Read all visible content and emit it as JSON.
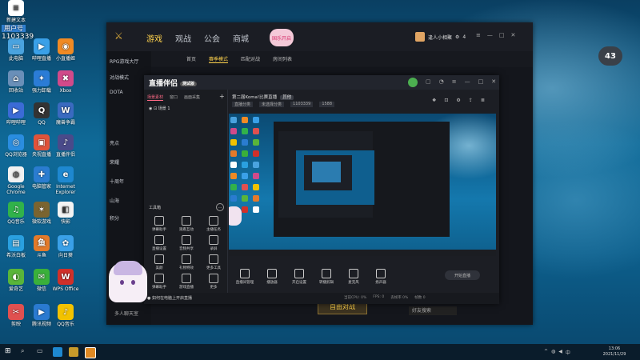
{
  "desktop": {
    "user_label": "用户号",
    "user_id": "1103339",
    "icons": [
      {
        "label": "此电脑",
        "color": "#4aa3df",
        "glyph": "▭"
      },
      {
        "label": "哔哩直播",
        "color": "#3aa0e8",
        "glyph": "▶"
      },
      {
        "label": "小直播姬",
        "color": "#f08a24",
        "glyph": "◉"
      },
      {
        "label": "回收站",
        "color": "#6a8fb8",
        "glyph": "⌂"
      },
      {
        "label": "强力卸载",
        "color": "#2b7cd6",
        "glyph": "✦"
      },
      {
        "label": "Xbox",
        "color": "#d04a8a",
        "glyph": "✖"
      },
      {
        "label": "哔哩哔哩",
        "color": "#3b6bd6",
        "glyph": "▶"
      },
      {
        "label": "QQ",
        "color": "#333",
        "glyph": "Q"
      },
      {
        "label": "魔兽争霸",
        "color": "#3a6ac0",
        "glyph": "W"
      },
      {
        "label": "QQ浏览器",
        "color": "#2a8de0",
        "glyph": "◎"
      },
      {
        "label": "央视直播",
        "color": "#e0533a",
        "glyph": "▣"
      },
      {
        "label": "直播伴侣",
        "color": "#4a4a8a",
        "glyph": "♪"
      },
      {
        "label": "Google Chrome",
        "color": "#f1f1f1",
        "glyph": "◍"
      },
      {
        "label": "电脑管家",
        "color": "#2a7cd0",
        "glyph": "✚"
      },
      {
        "label": "Internet Explorer",
        "color": "#1e88d0",
        "glyph": "e"
      },
      {
        "label": "QQ音乐",
        "color": "#31b24a",
        "glyph": "♫"
      },
      {
        "label": "微软游戏",
        "color": "#7a6430",
        "glyph": "✶"
      },
      {
        "label": "快影",
        "color": "#f3f3f3",
        "glyph": "◧"
      },
      {
        "label": "希沃白板",
        "color": "#2aa0e0",
        "glyph": "▤"
      },
      {
        "label": "斗鱼",
        "color": "#e37a2a",
        "glyph": "鱼"
      },
      {
        "label": "向日葵",
        "color": "#3aa0e8",
        "glyph": "✿"
      },
      {
        "label": "爱奇艺",
        "color": "#59b53a",
        "glyph": "◐"
      },
      {
        "label": "微信",
        "color": "#3ab03a",
        "glyph": "✉"
      },
      {
        "label": "WPS Office",
        "color": "#d0302a",
        "glyph": "W"
      },
      {
        "label": "剪映",
        "color": "#e05050",
        "glyph": "✂"
      },
      {
        "label": "腾讯视频",
        "color": "#2a7ad0",
        "glyph": "▶"
      },
      {
        "label": "QQ音乐",
        "color": "#f2c200",
        "glyph": "♪"
      },
      {
        "label": "新建文本",
        "color": "#ffffff",
        "glyph": "≡"
      }
    ],
    "bubble_value": "43"
  },
  "launcher": {
    "nav": [
      "游戏",
      "观战",
      "公会",
      "商城"
    ],
    "active_nav": "游戏",
    "mascot_text": "国乐开启",
    "user_name": "逢人小相聚",
    "count": "4",
    "sub_tabs": [
      "首页",
      "赛季模式",
      "匹配对战",
      "房间列表"
    ],
    "side_items": [
      "RPG游戏大厅",
      "对战模式",
      "DOTA",
      "",
      "亮点",
      "荣耀",
      "十周年",
      "山海",
      "积分"
    ],
    "bottom_btn": "自由对战",
    "bottom_left": "多人聊天室",
    "bottom_search": "好友搜索"
  },
  "stream": {
    "logo": "直播伴侣",
    "version": "测试版",
    "left_tabs": [
      "场景素材",
      "窗口",
      "画面采集"
    ],
    "scene_name": "场景 1",
    "toolbox_title": "工具箱",
    "tools": [
      "弹幕助手",
      "观看互动",
      "主播任务",
      "直播设置",
      "音频共享",
      "录屏",
      "美颜",
      "礼物特效",
      "更多工具",
      "弹幕助手",
      "游戏直播",
      "更多"
    ],
    "title": "第二届Koma!比赛直播",
    "title_tag": "其他",
    "meta": [
      "直播分类",
      "未选择分类",
      "1103339",
      "1588"
    ],
    "controls": [
      "直播间管理",
      "播放器",
      "开启设置",
      "转播剪辑",
      "麦克风",
      "扬声器"
    ],
    "start_btn": "开始直播",
    "status_msg": "如何在电脑上开启直播",
    "status_right": [
      "当前CPU: 0%",
      "FPS: 0",
      "丢帧率 0%",
      "帧数 0"
    ]
  },
  "taskbar": {
    "time": "13:06",
    "date": "2021/11/29"
  }
}
